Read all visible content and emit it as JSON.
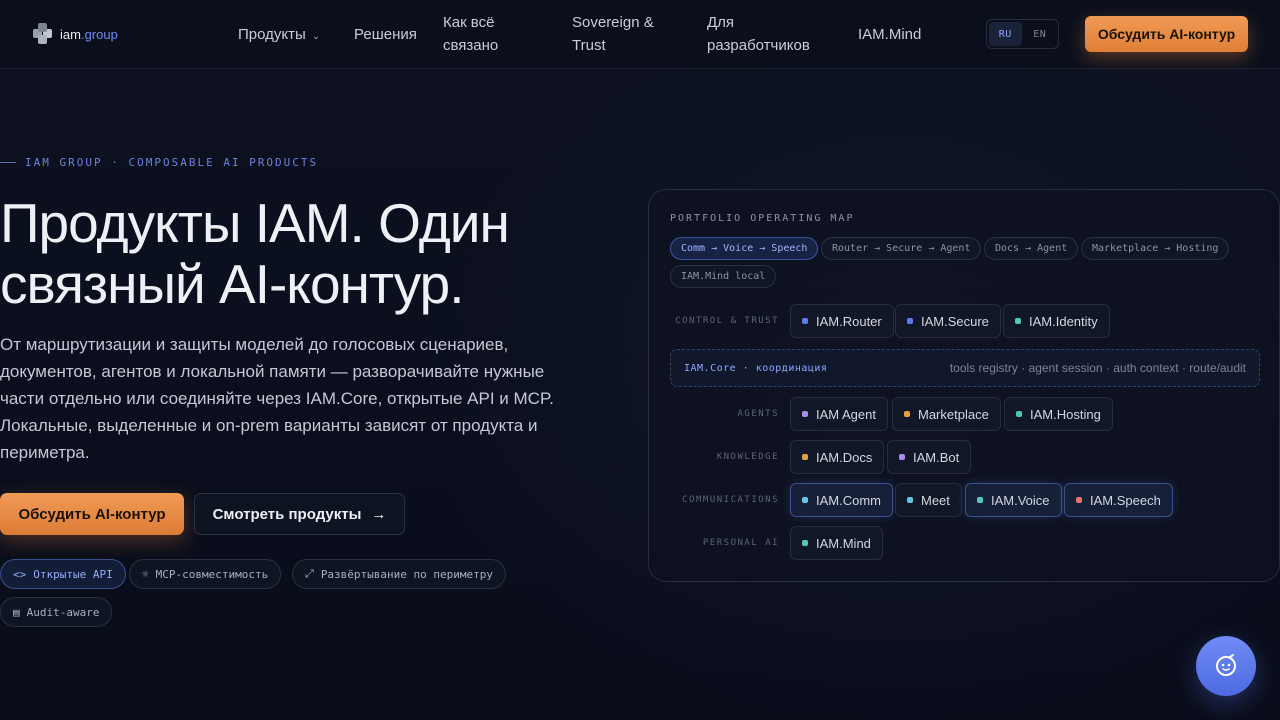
{
  "header": {
    "logo": {
      "prefix": "iam",
      "accent": ".group"
    },
    "nav": [
      {
        "label": "Продукты",
        "has_dropdown": true
      },
      {
        "label": "Решения"
      },
      {
        "label": "Как всё связано"
      },
      {
        "label": "Sovereign & Trust"
      },
      {
        "label": "Для разработчиков"
      },
      {
        "label": "IAM.Mind"
      }
    ],
    "lang": {
      "options": [
        "RU",
        "EN"
      ],
      "selected": "RU"
    },
    "cta": "Обсудить AI-контур"
  },
  "hero": {
    "eyebrow": "IAM GROUP · COMPOSABLE AI PRODUCTS",
    "title_line1": "Продукты IAM. Один",
    "title_line2": "связный AI-контур.",
    "description": "От маршрутизации и защиты моделей до голосовых сценариев, документов, агентов и локальной памяти — разворачивайте нужные части отдельно или соединяйте через IAM.Core, открытые API и MCP. Локальные, выделенные и on-prem варианты зависят от продукта и периметра.",
    "primary_button": "Обсудить AI-контур",
    "secondary_button": "Смотреть продукты",
    "chips": [
      {
        "icon": "<>",
        "label": "Открытые API",
        "active": true
      },
      {
        "icon": "☼",
        "label": "MCP-совместимость"
      },
      {
        "icon": "⤢",
        "label": "Развёртывание по периметру"
      },
      {
        "icon": "▤",
        "label": "Audit-aware"
      }
    ]
  },
  "map": {
    "title": "PORTFOLIO OPERATING MAP",
    "flows": [
      {
        "label": "Comm → Voice → Speech",
        "active": true
      },
      {
        "label": "Router → Secure → Agent"
      },
      {
        "label": "Docs → Agent"
      },
      {
        "label": "Marketplace → Hosting"
      },
      {
        "label": "IAM.Mind local"
      }
    ],
    "rows": {
      "control": {
        "label": "CONTROL & TRUST",
        "nodes": [
          "IAM.Router",
          "IAM.Secure",
          "IAM.Identity"
        ]
      },
      "core": {
        "label": "IAM.Core · координация",
        "meta": "tools registry · agent session · auth context · route/audit"
      },
      "agents": {
        "label": "AGENTS",
        "nodes": [
          "IAM Agent",
          "Marketplace",
          "IAM.Hosting"
        ]
      },
      "knowledge": {
        "label": "KNOWLEDGE",
        "nodes": [
          "IAM.Docs",
          "IAM.Bot"
        ]
      },
      "comms": {
        "label": "COMMUNICATIONS",
        "nodes": [
          "IAM.Comm",
          "Meet",
          "IAM.Voice",
          "IAM.Speech"
        ]
      },
      "personal": {
        "label": "PERSONAL AI",
        "nodes": [
          "IAM.Mind"
        ]
      }
    },
    "colors": {
      "blue": "#5b7cf0",
      "teal": "#4fc9b3",
      "purple": "#a98bf0",
      "amber": "#e0a040",
      "cyan": "#5fc6e8",
      "red": "#e8706a"
    }
  },
  "chat_button": {
    "icon": "chat-bot-icon"
  }
}
